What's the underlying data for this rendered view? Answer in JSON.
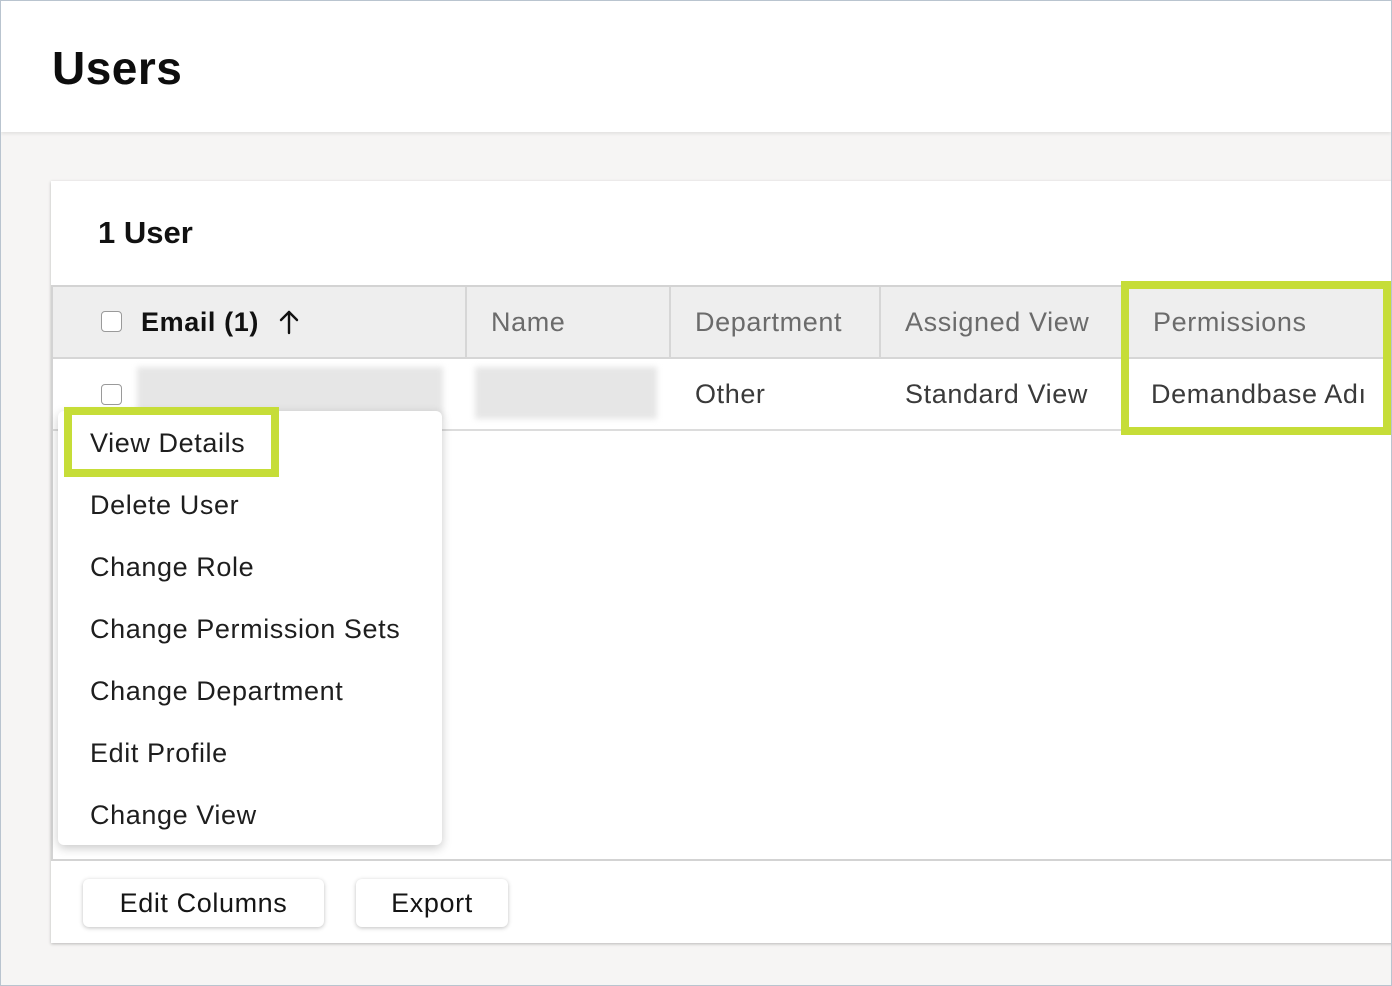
{
  "page": {
    "title": "Users"
  },
  "card": {
    "title": "1 User"
  },
  "table": {
    "columns": {
      "email": "Email (1)",
      "name": "Name",
      "department": "Department",
      "assigned_view": "Assigned View",
      "permissions": "Permissions"
    },
    "sort_icon": "arrow-up-icon",
    "rows": [
      {
        "email": "",
        "name": "",
        "department": "Other",
        "assigned_view": "Standard View",
        "permissions": "Demandbase Adı"
      }
    ]
  },
  "context_menu": {
    "items": [
      "View Details",
      "Delete User",
      "Change Role",
      "Change Permission Sets",
      "Change Department",
      "Edit Profile",
      "Change View"
    ]
  },
  "footer": {
    "edit_columns_label": "Edit Columns",
    "export_label": "Export"
  },
  "colors": {
    "highlight": "#c6dd38",
    "header_bg": "#eeeeee",
    "page_bg": "#f6f5f4"
  }
}
